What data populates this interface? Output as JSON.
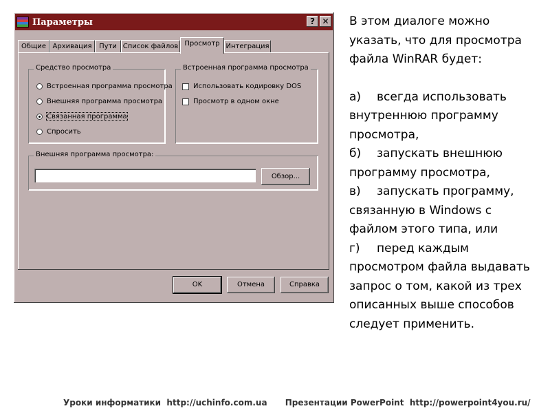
{
  "dialog": {
    "title": "Параметры",
    "help_button": "?",
    "close_button": "✕",
    "tabs": [
      {
        "label": "Общие"
      },
      {
        "label": "Архивация"
      },
      {
        "label": "Пути"
      },
      {
        "label": "Список файлов"
      },
      {
        "label": "Просмотр",
        "active": true
      },
      {
        "label": "Интеграция"
      }
    ],
    "viewer_group": {
      "label": "Средство просмотра",
      "options": [
        {
          "label": "Встроенная программа просмотра",
          "selected": false
        },
        {
          "label": "Внешняя программа просмотра",
          "selected": false
        },
        {
          "label": "Связанная программа",
          "selected": true
        },
        {
          "label": "Спросить",
          "selected": false
        }
      ]
    },
    "internal_group": {
      "label": "Встроенная программа просмотра",
      "options": [
        {
          "label": "Использовать кодировку DOS",
          "checked": false
        },
        {
          "label": "Просмотр в одном окне",
          "checked": false
        }
      ]
    },
    "external_group": {
      "label": "Внешняя программа просмотра:",
      "path_value": "",
      "browse_button": "Обзор..."
    },
    "buttons": {
      "ok": "OK",
      "cancel": "Отмена",
      "help": "Справка"
    }
  },
  "description": {
    "intro": "В этом диалоге можно указать, что для просмотра файла WinRAR будет:",
    "items": [
      {
        "marker": "а)",
        "text": "всегда использовать внутреннюю программу просмотра,"
      },
      {
        "marker": "б)",
        "text": "запускать внешнюю программу просмотра,"
      },
      {
        "marker": "в)",
        "text": "запускать программу, связанную в Windows с файлом этого типа, или"
      },
      {
        "marker": "г)",
        "text": "перед каждым просмотром файла выдавать запрос о том, какой из трех описанных выше способов следует применить."
      }
    ]
  },
  "footer": {
    "left": "Уроки информатики  http://uchinfo.com.ua",
    "right": "Презентации PowerPoint  http://powerpoint4you.ru/"
  }
}
